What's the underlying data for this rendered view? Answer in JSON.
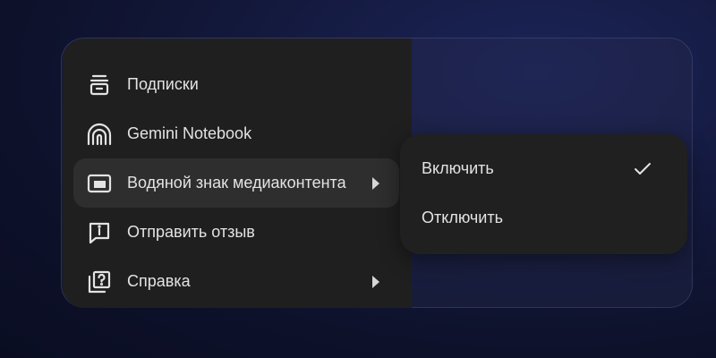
{
  "menu": {
    "items": [
      {
        "label": "Подписки",
        "icon": "subscriptions-icon",
        "has_submenu": false
      },
      {
        "label": "Gemini Notebook",
        "icon": "notebook-icon",
        "has_submenu": false
      },
      {
        "label": "Водяной знак медиаконтента",
        "icon": "watermark-icon",
        "has_submenu": true,
        "active": true
      },
      {
        "label": "Отправить отзыв",
        "icon": "feedback-icon",
        "has_submenu": false
      },
      {
        "label": "Справка",
        "icon": "help-icon",
        "has_submenu": true
      }
    ]
  },
  "submenu": {
    "items": [
      {
        "label": "Включить",
        "checked": true
      },
      {
        "label": "Отключить",
        "checked": false
      }
    ]
  },
  "colors": {
    "menu_bg": "#1f1f1f",
    "active_bg": "#2e2e2e",
    "text": "#e3e3e3",
    "background": "#141a3f"
  }
}
